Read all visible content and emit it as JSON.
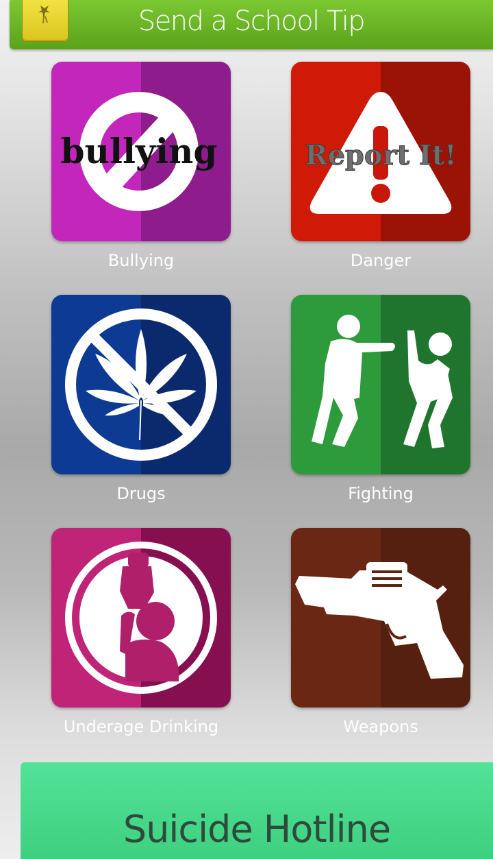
{
  "header": {
    "title": "Send a School Tip",
    "logo_icon": "school-tip-app-logo"
  },
  "tiles": [
    {
      "label": "Bullying",
      "icon": "no-bullying-icon",
      "icon_text": "bullying",
      "colors": [
        "#c326ba",
        "#8e1c8d"
      ]
    },
    {
      "label": "Danger",
      "icon": "danger-warning-icon",
      "icon_text": "Report It!",
      "colors": [
        "#d01a08",
        "#9b1207"
      ]
    },
    {
      "label": "Drugs",
      "icon": "no-drugs-icon",
      "colors": [
        "#0d3b94",
        "#0b2a6d"
      ]
    },
    {
      "label": "Fighting",
      "icon": "fighting-icon",
      "colors": [
        "#2d9a3c",
        "#20752e"
      ]
    },
    {
      "label": "Underage Drinking",
      "icon": "underage-drinking-icon",
      "colors": [
        "#c02477",
        "#86104f"
      ]
    },
    {
      "label": "Weapons",
      "icon": "weapon-gun-icon",
      "colors": [
        "#6a2814",
        "#55200f"
      ]
    }
  ],
  "hotline": {
    "label": "Suicide Hotline",
    "color": "#4ddb8f"
  }
}
